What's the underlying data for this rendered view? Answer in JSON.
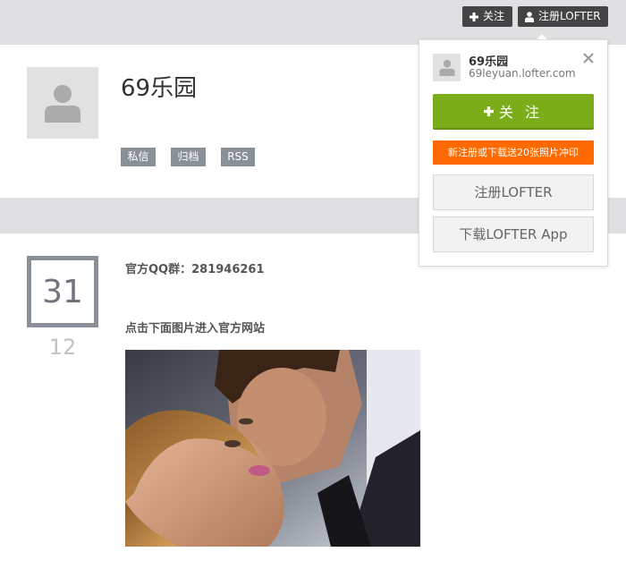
{
  "topbar": {
    "follow_label": "关注",
    "register_label": "注册LOFTER"
  },
  "blog": {
    "title": "69乐园",
    "tags": [
      "私信",
      "归档",
      "RSS"
    ]
  },
  "post": {
    "day": "31",
    "month": "12",
    "line1": "官方QQ群：281946261",
    "line2": "点击下面图片进入官方网站"
  },
  "popup": {
    "name": "69乐园",
    "url": "69leyuan.lofter.com",
    "follow_label": "关 注",
    "promo": "新注册或下载送20张照片冲印",
    "register_label": "注册LOFTER",
    "download_label": "下载LOFTER App"
  },
  "icons": {
    "plus": "plus-icon",
    "user": "user-icon",
    "close": "close-icon",
    "avatar": "avatar-placeholder-icon"
  },
  "colors": {
    "topbar_bg": "#e0e0e2",
    "dark_button": "#444446",
    "tag_bg": "#8a9097",
    "follow_green": "#7bac1a",
    "promo_orange": "#ff6a00"
  }
}
